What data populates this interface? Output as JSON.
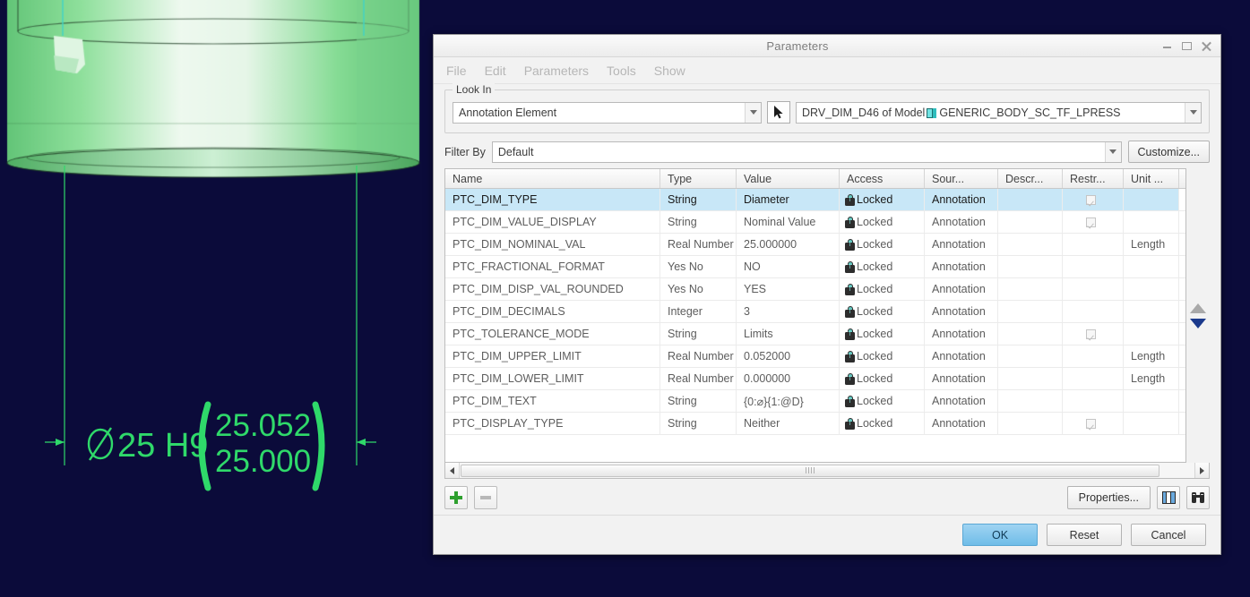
{
  "window": {
    "title": "Parameters",
    "controls": {
      "minimize": "−",
      "maximize": "▢",
      "close": "✕"
    }
  },
  "menubar": {
    "items": [
      {
        "label": "File"
      },
      {
        "label": "Edit"
      },
      {
        "label": "Parameters"
      },
      {
        "label": "Tools"
      },
      {
        "label": "Show"
      }
    ]
  },
  "lookin": {
    "group_title": "Look In",
    "type_value": "Annotation Element",
    "model_prefix": "DRV_DIM_D46 of Model",
    "model_name": "GENERIC_BODY_SC_TF_LPRESS",
    "pick_icon": "cursor-arrow-icon"
  },
  "filter": {
    "label": "Filter By",
    "value": "Default",
    "customize_label": "Customize..."
  },
  "table": {
    "columns": [
      "Name",
      "Type",
      "Value",
      "Access",
      "Sour...",
      "Descr...",
      "Restr...",
      "Unit ..."
    ],
    "rows": [
      {
        "name": "PTC_DIM_TYPE",
        "type": "String",
        "value": "Diameter",
        "access": "Locked",
        "source": "Annotation",
        "descr": "",
        "restr": true,
        "unit": "",
        "selected": true
      },
      {
        "name": "PTC_DIM_VALUE_DISPLAY",
        "type": "String",
        "value": "Nominal Value",
        "access": "Locked",
        "source": "Annotation",
        "descr": "",
        "restr": true,
        "unit": "",
        "selected": false
      },
      {
        "name": "PTC_DIM_NOMINAL_VAL",
        "type": "Real Number",
        "value": "25.000000",
        "access": "Locked",
        "source": "Annotation",
        "descr": "",
        "restr": false,
        "unit": "Length",
        "selected": false
      },
      {
        "name": "PTC_FRACTIONAL_FORMAT",
        "type": "Yes No",
        "value": "NO",
        "access": "Locked",
        "source": "Annotation",
        "descr": "",
        "restr": false,
        "unit": "",
        "selected": false
      },
      {
        "name": "PTC_DIM_DISP_VAL_ROUNDED",
        "type": "Yes No",
        "value": "YES",
        "access": "Locked",
        "source": "Annotation",
        "descr": "",
        "restr": false,
        "unit": "",
        "selected": false
      },
      {
        "name": "PTC_DIM_DECIMALS",
        "type": "Integer",
        "value": "3",
        "access": "Locked",
        "source": "Annotation",
        "descr": "",
        "restr": false,
        "unit": "",
        "selected": false
      },
      {
        "name": "PTC_TOLERANCE_MODE",
        "type": "String",
        "value": "Limits",
        "access": "Locked",
        "source": "Annotation",
        "descr": "",
        "restr": true,
        "unit": "",
        "selected": false
      },
      {
        "name": "PTC_DIM_UPPER_LIMIT",
        "type": "Real Number",
        "value": "0.052000",
        "access": "Locked",
        "source": "Annotation",
        "descr": "",
        "restr": false,
        "unit": "Length",
        "selected": false
      },
      {
        "name": "PTC_DIM_LOWER_LIMIT",
        "type": "Real Number",
        "value": "0.000000",
        "access": "Locked",
        "source": "Annotation",
        "descr": "",
        "restr": false,
        "unit": "Length",
        "selected": false
      },
      {
        "name": "PTC_DIM_TEXT",
        "type": "String",
        "value": "{0:⌀}{1:@D}",
        "access": "Locked",
        "source": "Annotation",
        "descr": "",
        "restr": false,
        "unit": "",
        "selected": false
      },
      {
        "name": "PTC_DISPLAY_TYPE",
        "type": "String",
        "value": "Neither",
        "access": "Locked",
        "source": "Annotation",
        "descr": "",
        "restr": true,
        "unit": "",
        "selected": false
      }
    ]
  },
  "toolbar": {
    "add_label": "+",
    "remove_label": "−",
    "properties_label": "Properties...",
    "grid_icon": "table-columns-icon",
    "find_icon": "binoculars-icon"
  },
  "footer": {
    "ok_label": "OK",
    "reset_label": "Reset",
    "cancel_label": "Cancel"
  },
  "cad": {
    "dimension_symbol": "⌀",
    "dimension_nominal": "25 H9",
    "limit_upper": "25.052",
    "limit_lower": "25.000",
    "colors": {
      "background": "#0b0b3a",
      "annotation": "#2fd96a",
      "part": "#8fe39a"
    }
  }
}
